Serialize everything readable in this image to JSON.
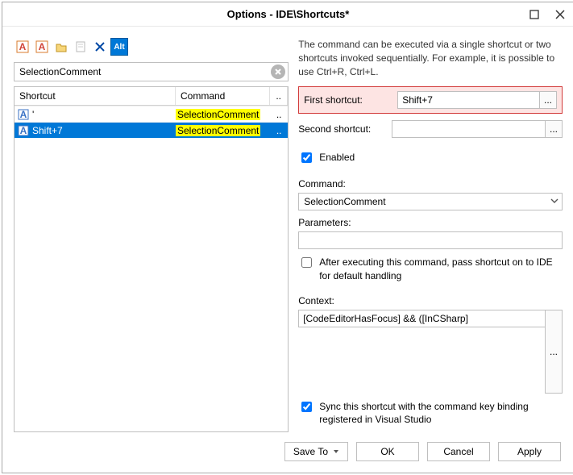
{
  "window": {
    "title": "Options - IDE\\Shortcuts*"
  },
  "toolbar": {
    "icons": [
      "font-larger-icon",
      "font-smaller-icon",
      "folder-icon",
      "page-icon",
      "delete-icon",
      "alt-key-icon"
    ],
    "alt_label": "Alt"
  },
  "search": {
    "value": "SelectionComment"
  },
  "grid": {
    "headers": {
      "shortcut": "Shortcut",
      "command": "Command",
      "menu": ".."
    },
    "rows": [
      {
        "shortcut": "'",
        "command": "SelectionComment",
        "selected": false,
        "highlight": true
      },
      {
        "shortcut": "Shift+7",
        "command": "SelectionComment",
        "selected": true,
        "highlight": true
      }
    ]
  },
  "description": "The command can be executed via a single shortcut or two shortcuts invoked sequentially. For example, it is possible to use Ctrl+R, Ctrl+L.",
  "firstShortcut": {
    "label": "First shortcut:",
    "value": "Shift+7",
    "btn": "..."
  },
  "secondShortcut": {
    "label": "Second shortcut:",
    "value": "",
    "btn": "..."
  },
  "enabled": {
    "label": "Enabled",
    "checked": true
  },
  "commandLbl": "Command:",
  "commandValue": "SelectionComment",
  "paramsLbl": "Parameters:",
  "paramsValue": "",
  "passOn": {
    "label": "After executing this command, pass shortcut on to IDE for default handling",
    "checked": false
  },
  "contextLbl": "Context:",
  "contextValue": "[CodeEditorHasFocus] && ([InCSharp]",
  "contextBtn": "...",
  "sync": {
    "label": "Sync this shortcut with the command key binding registered in Visual Studio",
    "checked": true
  },
  "footer": {
    "saveTo": "Save To",
    "ok": "OK",
    "cancel": "Cancel",
    "apply": "Apply"
  }
}
